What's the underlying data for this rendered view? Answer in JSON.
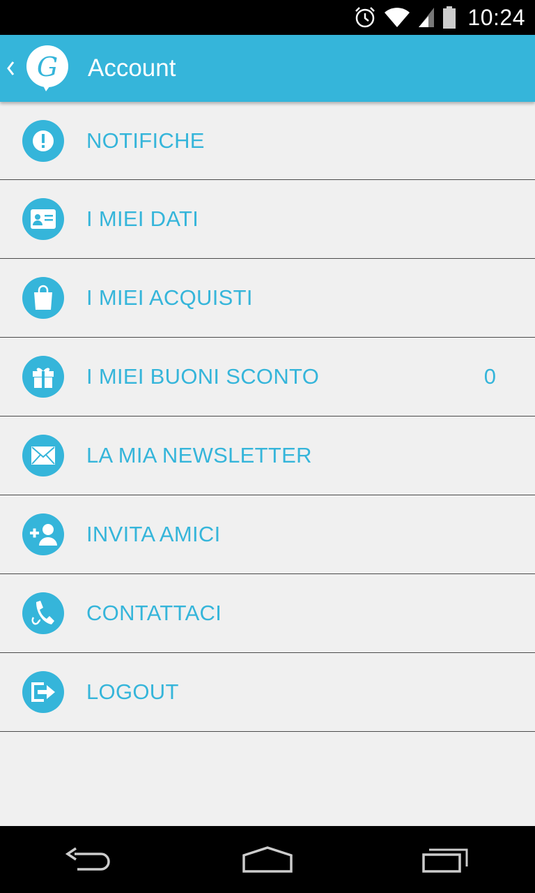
{
  "status_bar": {
    "time": "10:24",
    "icons": [
      "alarm-icon",
      "wifi-icon",
      "signal-icon",
      "battery-icon"
    ]
  },
  "app_bar": {
    "title": "Account",
    "logo_letter": "G",
    "back_icon": "chevron-left-icon"
  },
  "menu": {
    "items": [
      {
        "label": "NOTIFICHE",
        "icon": "exclamation-icon"
      },
      {
        "label": "I MIEI DATI",
        "icon": "id-card-icon"
      },
      {
        "label": "I MIEI ACQUISTI",
        "icon": "shopping-bag-icon"
      },
      {
        "label": "I MIEI BUONI SCONTO",
        "icon": "gift-icon",
        "badge": "0"
      },
      {
        "label": "LA MIA NEWSLETTER",
        "icon": "envelope-icon"
      },
      {
        "label": "INVITA AMICI",
        "icon": "add-user-icon"
      },
      {
        "label": "CONTATTACI",
        "icon": "phone-icon"
      },
      {
        "label": "LOGOUT",
        "icon": "logout-icon"
      }
    ]
  },
  "nav_bar": {
    "buttons": [
      "back-icon",
      "home-icon",
      "recents-icon"
    ]
  },
  "colors": {
    "accent": "#35b5da",
    "background": "#f0f0f0",
    "divider": "#4a4a4a",
    "system_bars": "#000000"
  }
}
